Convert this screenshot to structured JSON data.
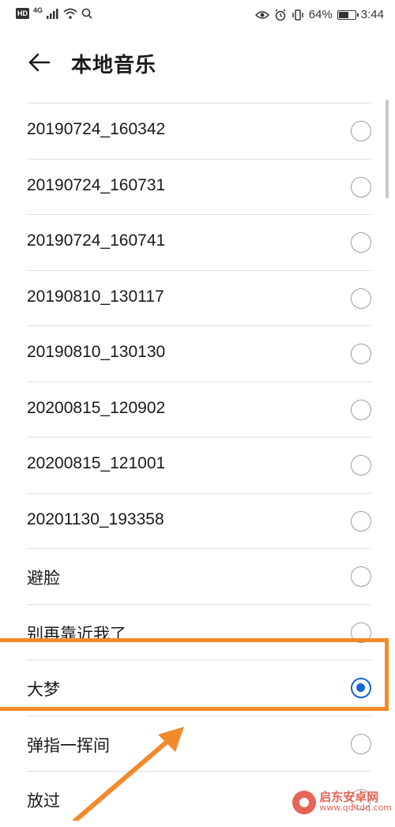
{
  "status_bar": {
    "hd": "HD",
    "network": "4G",
    "battery": "64%",
    "battery_level": 0.64,
    "time": "3:44"
  },
  "header": {
    "title": "本地音乐",
    "back_icon": "arrow-left-icon"
  },
  "songs": [
    {
      "label": "20190724_160342",
      "selected": false
    },
    {
      "label": "20190724_160731",
      "selected": false
    },
    {
      "label": "20190724_160741",
      "selected": false
    },
    {
      "label": "20190810_130117",
      "selected": false
    },
    {
      "label": "20190810_130130",
      "selected": false
    },
    {
      "label": "20200815_120902",
      "selected": false
    },
    {
      "label": "20200815_121001",
      "selected": false
    },
    {
      "label": "20201130_193358",
      "selected": false
    },
    {
      "label": "避脸",
      "selected": false
    },
    {
      "label": "别再靠近我了",
      "selected": false
    },
    {
      "label": "大梦",
      "selected": true
    },
    {
      "label": "弹指一挥间",
      "selected": false
    },
    {
      "label": "放过",
      "selected": false
    }
  ],
  "colors": {
    "accent": "#1565d8",
    "annotation": "#f28a2b",
    "watermark": "#e24b3a"
  },
  "watermark": {
    "title": "启东安卓网",
    "url": "www.qdltdq.com"
  }
}
